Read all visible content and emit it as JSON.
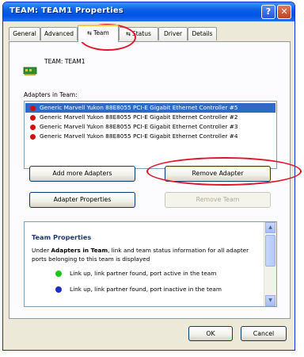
{
  "window": {
    "title": "TEAM: TEAM1 Properties",
    "help_label": "?",
    "close_label": "✕"
  },
  "tabs": [
    {
      "label": "General"
    },
    {
      "label": "Advanced"
    },
    {
      "label": "Team"
    },
    {
      "label": "Status"
    },
    {
      "label": "Driver"
    },
    {
      "label": "Details"
    }
  ],
  "team": {
    "name": "TEAM: TEAM1",
    "adapters_label": "Adapters in Team:",
    "adapters": [
      {
        "label": "Generic Marvell Yukon 88E8055 PCI-E Gigabit Ethernet Controller #5",
        "status_color": "#c81212"
      },
      {
        "label": "Generic Marvell Yukon 88E8055 PCI-E Gigabit Ethernet Controller #2",
        "status_color": "#d01010"
      },
      {
        "label": "Generic Marvell Yukon 88E8055 PCI-E Gigabit Ethernet Controller #3",
        "status_color": "#d01010"
      },
      {
        "label": "Generic Marvell Yukon 88E8055 PCI-E Gigabit Ethernet Controller #4",
        "status_color": "#d01010"
      }
    ]
  },
  "buttons": {
    "add_more_adapters": "Add more Adapters",
    "remove_adapter": "Remove Adapter",
    "adapter_properties": "Adapter Properties",
    "remove_team": "Remove Team",
    "ok": "OK",
    "cancel": "Cancel"
  },
  "info": {
    "title": "Team Properties",
    "desc_prefix": "Under ",
    "desc_bold": "Adapters in Team",
    "desc_suffix": ", link and team status information for all adapter ports belonging to this team is displayed",
    "legend": [
      {
        "label": "Link up, link partner found, port active in the team",
        "color": "#19c819"
      },
      {
        "label": "Link up, link partner found, port inactive in the team",
        "color": "#1b2fc8"
      }
    ]
  },
  "colors": {
    "annotation": "#e0162b",
    "titlebar": "#0054e3",
    "selection": "#316ac5"
  }
}
